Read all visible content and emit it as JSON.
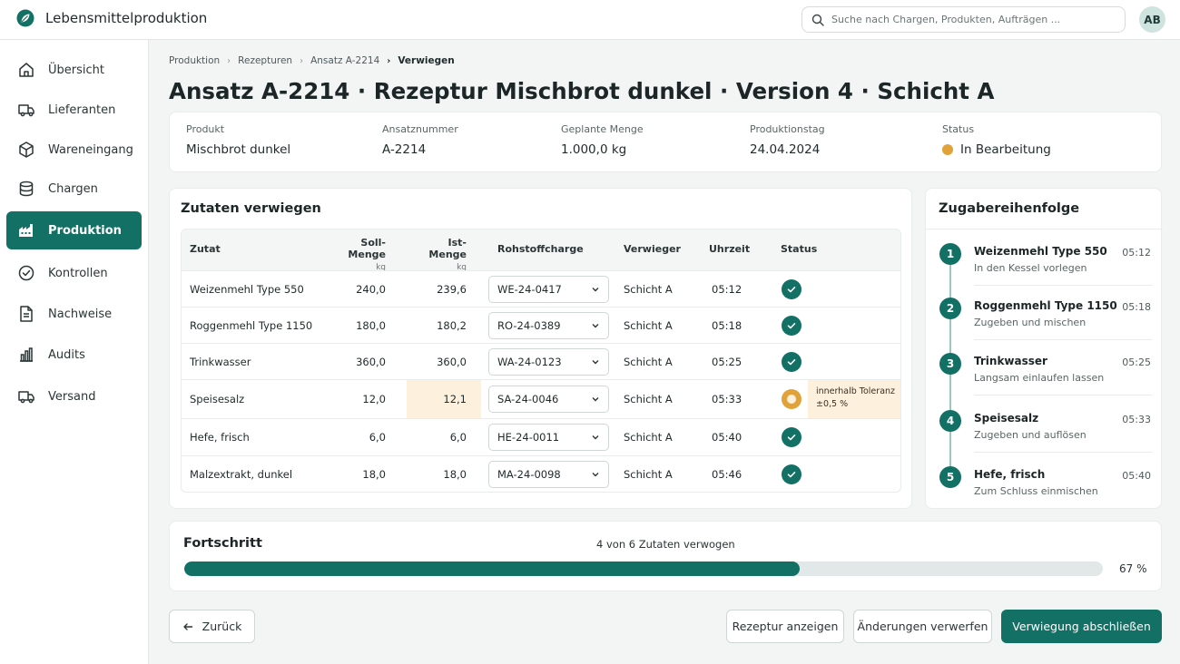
{
  "app": {
    "title": "Lebensmittelproduktion",
    "logo_icon": "leaf-icon",
    "accent": "#137065"
  },
  "search": {
    "placeholder": "Suche nach Chargen, Produkten, Aufträgen ..."
  },
  "user": {
    "initials": "AB"
  },
  "sidebar": {
    "items": [
      {
        "label": "Übersicht",
        "icon": "home-icon",
        "active": false
      },
      {
        "label": "Lieferanten",
        "icon": "truck-icon",
        "active": false
      },
      {
        "label": "Wareneingang",
        "icon": "box-icon",
        "active": false
      },
      {
        "label": "Chargen",
        "icon": "database-icon",
        "active": false
      },
      {
        "label": "Produktion",
        "icon": "factory-icon",
        "active": true
      },
      {
        "label": "Kontrollen",
        "icon": "check-circle-icon",
        "active": false
      },
      {
        "label": "Nachweise",
        "icon": "document-icon",
        "active": false
      },
      {
        "label": "Audits",
        "icon": "bar-chart-icon",
        "active": false
      },
      {
        "label": "Versand",
        "icon": "truck-icon",
        "active": false
      }
    ]
  },
  "breadcrumb": [
    "Produktion",
    "Rezepturen",
    "Ansatz A-2214",
    "Verwiegen"
  ],
  "page_title": "Ansatz A-2214 · Rezeptur Mischbrot dunkel · Version 4 · Schicht A",
  "summary": {
    "product": {
      "label": "Produkt",
      "value": "Mischbrot dunkel"
    },
    "batch": {
      "label": "Ansatznummer",
      "value": "A-2214"
    },
    "planned": {
      "label": "Geplante Menge",
      "value": "1.000,0 kg"
    },
    "date": {
      "label": "Produktionstag",
      "value": "24.04.2024"
    },
    "status": {
      "label": "Status",
      "value": "In Bearbeitung",
      "color": "#e1a23a"
    }
  },
  "ingredients": {
    "title": "Zutaten verwiegen",
    "columns": {
      "ingredient": "Zutat",
      "target": "Soll-Menge",
      "target_unit": "kg",
      "actual": "Ist-Menge",
      "actual_unit": "kg",
      "lot": "Rohstoffcharge",
      "weigher": "Verwieger",
      "time": "Uhrzeit",
      "status": "Status"
    },
    "rows": [
      {
        "name": "Weizenmehl Type 550",
        "target": "240,0",
        "actual": "239,6",
        "lot": "WE-24-0417",
        "weigher": "Schicht A",
        "time": "05:12",
        "status": "ok"
      },
      {
        "name": "Roggenmehl Type 1150",
        "target": "180,0",
        "actual": "180,2",
        "lot": "RO-24-0389",
        "weigher": "Schicht A",
        "time": "05:18",
        "status": "ok"
      },
      {
        "name": "Trinkwasser",
        "target": "360,0",
        "actual": "360,0",
        "lot": "WA-24-0123",
        "weigher": "Schicht A",
        "time": "05:25",
        "status": "ok"
      },
      {
        "name": "Speisesalz",
        "target": "12,0",
        "actual": "12,1",
        "lot": "SA-24-0046",
        "weigher": "Schicht A",
        "time": "05:33",
        "status": "warn",
        "note_line1": "innerhalb Toleranz",
        "note_line2": "±0,5 %"
      },
      {
        "name": "Hefe, frisch",
        "target": "6,0",
        "actual": "6,0",
        "lot": "HE-24-0011",
        "weigher": "Schicht A",
        "time": "05:40",
        "status": "ok"
      },
      {
        "name": "Malzextrakt, dunkel",
        "target": "18,0",
        "actual": "18,0",
        "lot": "MA-24-0098",
        "weigher": "Schicht A",
        "time": "05:46",
        "status": "ok"
      }
    ]
  },
  "sequence": {
    "title": "Zugabereihenfolge",
    "steps": [
      {
        "num": "1",
        "name": "Weizenmehl Type 550",
        "desc": "In den Kessel vorlegen",
        "time": "05:12"
      },
      {
        "num": "2",
        "name": "Roggenmehl Type 1150",
        "desc": "Zugeben und mischen",
        "time": "05:18"
      },
      {
        "num": "3",
        "name": "Trinkwasser",
        "desc": "Langsam einlaufen lassen",
        "time": "05:25"
      },
      {
        "num": "4",
        "name": "Speisesalz",
        "desc": "Zugeben und auflösen",
        "time": "05:33"
      },
      {
        "num": "5",
        "name": "Hefe, frisch",
        "desc": "Zum Schluss einmischen",
        "time": "05:40"
      }
    ]
  },
  "progress": {
    "title": "Fortschritt",
    "count_text": "4 von 6 Zutaten verwogen",
    "percent_text": "67 %",
    "fraction": 0.67
  },
  "actions": {
    "back": "Zurück",
    "show_recipe": "Rezeptur anzeigen",
    "discard": "Änderungen verwerfen",
    "finish": "Verwiegung abschließen"
  }
}
